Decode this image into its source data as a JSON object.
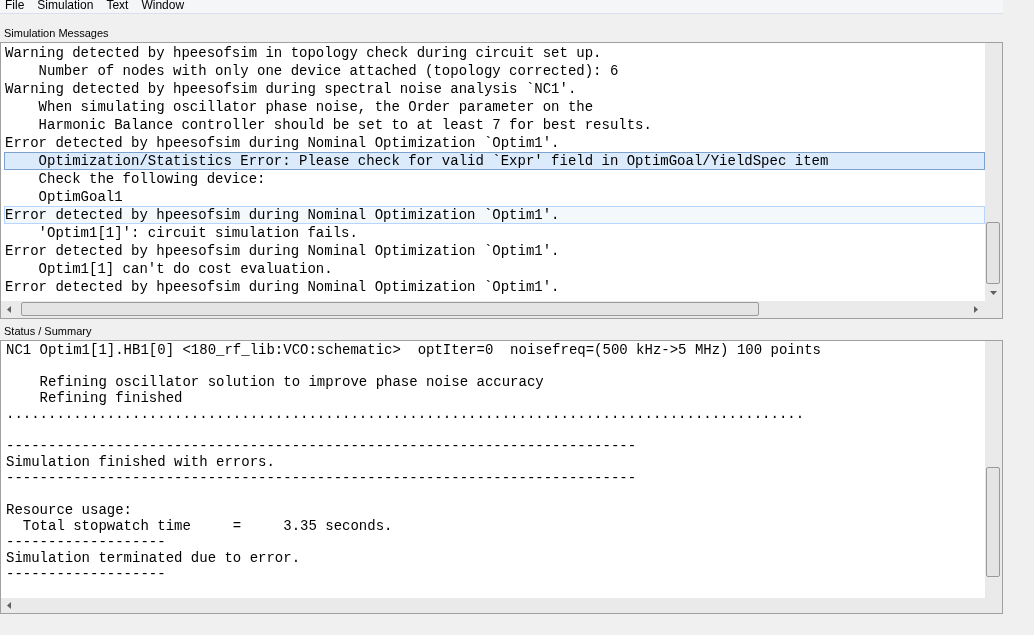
{
  "menu": [
    "File",
    "Simulation",
    "Text",
    "Window"
  ],
  "messages": {
    "title": "Simulation Messages",
    "rows": [
      {
        "text": "Warning detected by hpeesofsim in topology check during circuit set up.",
        "selected": false,
        "hovered": false
      },
      {
        "text": "    Number of nodes with only one device attached (topology corrected): 6",
        "selected": false,
        "hovered": false
      },
      {
        "text": "Warning detected by hpeesofsim during spectral noise analysis `NC1'.",
        "selected": false,
        "hovered": false
      },
      {
        "text": "    When simulating oscillator phase noise, the Order parameter on the",
        "selected": false,
        "hovered": false
      },
      {
        "text": "    Harmonic Balance controller should be set to at least 7 for best results.",
        "selected": false,
        "hovered": false
      },
      {
        "text": "Error detected by hpeesofsim during Nominal Optimization `Optim1'.",
        "selected": false,
        "hovered": false
      },
      {
        "text": "    Optimization/Statistics Error: Please check for valid `Expr' field in OptimGoal/YieldSpec item",
        "selected": true,
        "hovered": false
      },
      {
        "text": "    Check the following device:",
        "selected": false,
        "hovered": false
      },
      {
        "text": "    OptimGoal1",
        "selected": false,
        "hovered": false
      },
      {
        "text": "Error detected by hpeesofsim during Nominal Optimization `Optim1'.",
        "selected": false,
        "hovered": true
      },
      {
        "text": "    'Optim1[1]': circuit simulation fails.",
        "selected": false,
        "hovered": false
      },
      {
        "text": "Error detected by hpeesofsim during Nominal Optimization `Optim1'.",
        "selected": false,
        "hovered": false
      },
      {
        "text": "    Optim1[1] can't do cost evaluation.",
        "selected": false,
        "hovered": false
      },
      {
        "text": "Error detected by hpeesofsim during Nominal Optimization `Optim1'.",
        "selected": false,
        "hovered": false
      }
    ]
  },
  "status": {
    "title": "Status / Summary",
    "blocks": [
      {
        "lines": [
          "NC1 Optim1[1].HB1[0] <180_rf_lib:VCO:schematic>  optIter=0  noisefreq=(500 kHz->5 MHz) 100 points"
        ]
      },
      {
        "lines": [
          "    Refining oscillator solution to improve phase noise accuracy",
          "    Refining finished",
          "..............................................................................................."
        ]
      },
      {
        "lines": [
          "---------------------------------------------------------------------------",
          "Simulation finished with errors.",
          "---------------------------------------------------------------------------"
        ]
      },
      {
        "lines": [
          "Resource usage:",
          "  Total stopwatch time     =     3.35 seconds.",
          "-------------------",
          "Simulation terminated due to error.",
          "-------------------"
        ]
      }
    ]
  }
}
